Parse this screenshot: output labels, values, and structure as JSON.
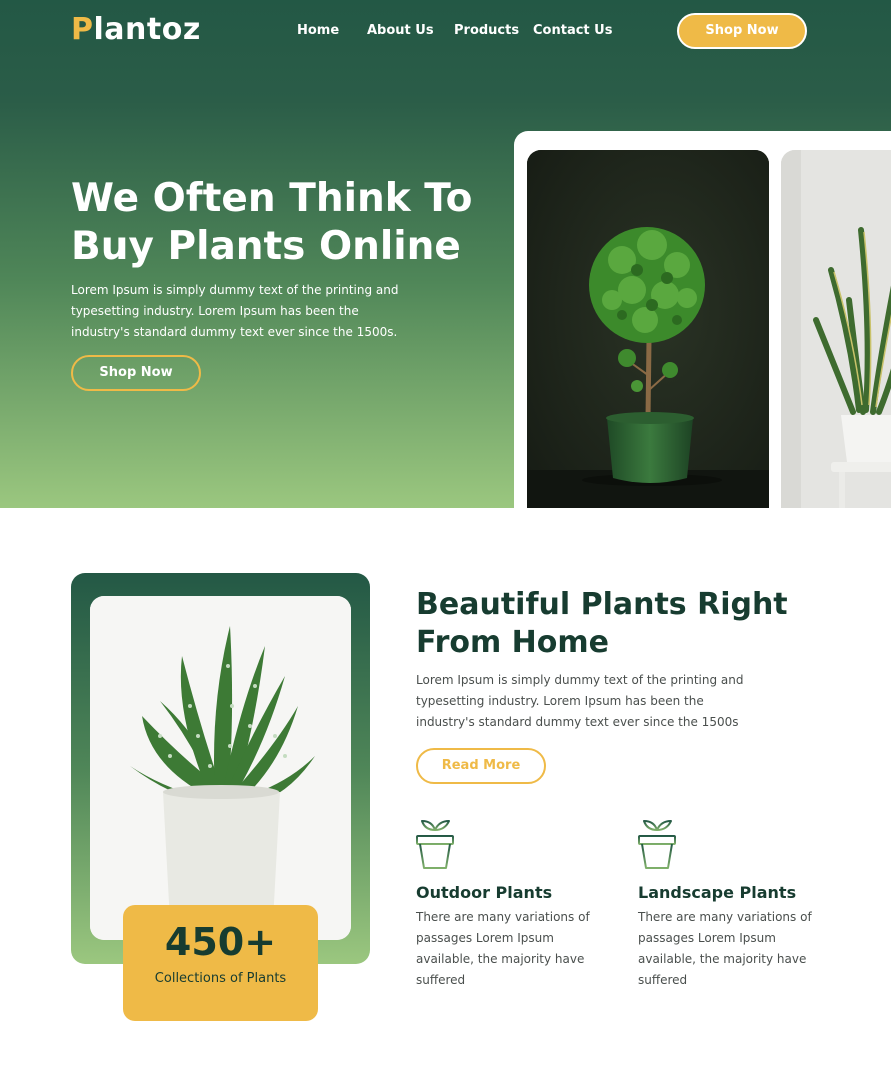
{
  "brand": {
    "logo_first_letter": "P",
    "logo_rest": "lantoz"
  },
  "nav": {
    "items": [
      "Home",
      "About Us",
      "Products",
      "Contact Us"
    ],
    "cta_label": "Shop Now"
  },
  "hero": {
    "title": "We Often Think To Buy Plants Online",
    "text": "Lorem Ipsum is simply dummy text of the printing and typesetting industry. Lorem Ipsum has been the industry's standard dummy text ever since the 1500s.",
    "button_label": "Shop Now",
    "images": [
      "potted-topiary-plant-photo",
      "snake-plant-photo"
    ]
  },
  "about": {
    "title": "Beautiful Plants Right From Home",
    "text": "Lorem Ipsum is simply dummy text of the printing and typesetting industry. Lorem Ipsum has been the industry's standard dummy text ever since the 1500s",
    "button_label": "Read More",
    "image": "aloe-plant-photo",
    "stat": {
      "number": "450+",
      "label": "Collections of Plants"
    },
    "features": [
      {
        "icon": "plant-pot-icon",
        "title": "Outdoor Plants",
        "text": "There are many variations of passages Lorem Ipsum available, the majority have suffered"
      },
      {
        "icon": "plant-pot-icon",
        "title": "Landscape Plants",
        "text": "There are many variations of passages Lorem Ipsum available, the majority have suffered"
      }
    ]
  },
  "colors": {
    "primary_dark": "#235845",
    "accent": "#efba47",
    "gradient_light": "#9bc77f",
    "heading": "#173c30"
  }
}
